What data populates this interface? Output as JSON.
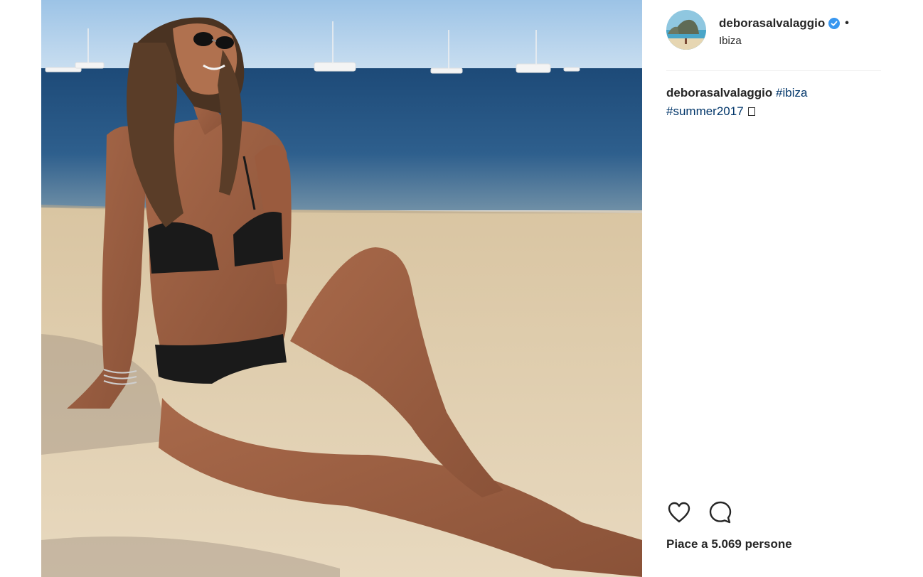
{
  "post": {
    "username": "deborasalvalaggio",
    "separator": "•",
    "location": "Ibiza",
    "caption": {
      "username": "deborasalvalaggio",
      "hashtag_1": "#ibiza",
      "hashtag_2": "#summer2017"
    },
    "likes_text": "Piace a 5.069 persone"
  },
  "icons": {
    "verified": "verified-badge-icon",
    "like": "heart-icon",
    "comment": "comment-bubble-icon"
  },
  "colors": {
    "hashtag": "#003569",
    "verified": "#3897f0",
    "text": "#262626",
    "divider": "#efefef"
  }
}
